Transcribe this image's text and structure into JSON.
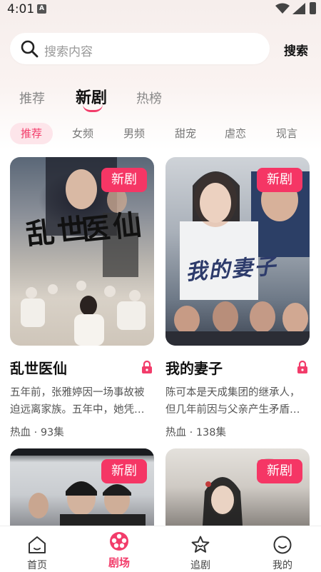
{
  "status_bar": {
    "time": "4:01",
    "notification_glyph": "A"
  },
  "search": {
    "placeholder": "搜索内容",
    "button_label": "搜索"
  },
  "top_tabs": [
    {
      "label": "推荐",
      "active": false
    },
    {
      "label": "新剧",
      "active": true
    },
    {
      "label": "热榜",
      "active": false
    }
  ],
  "categories": [
    {
      "label": "推荐",
      "active": true
    },
    {
      "label": "女频",
      "active": false
    },
    {
      "label": "男频",
      "active": false
    },
    {
      "label": "甜宠",
      "active": false
    },
    {
      "label": "虐恋",
      "active": false
    },
    {
      "label": "现言",
      "active": false
    }
  ],
  "cards": [
    {
      "badge": "新剧",
      "title": "乱世医仙",
      "desc_line1": "五年前，张雅婷因一场事故被",
      "desc_line2": "迫远离家族。五年中，她凭…",
      "meta": "热血 · 93集",
      "poster_text_1": "乱世",
      "poster_text_2": "医仙",
      "locked": true
    },
    {
      "badge": "新剧",
      "title": "我的妻子",
      "desc_line1": "陈可本是天成集团的继承人，",
      "desc_line2": "但几年前因与父亲产生矛盾…",
      "meta": "热血 · 138集",
      "poster_text": "我的妻子",
      "locked": true
    },
    {
      "badge": "新剧"
    },
    {
      "badge": "新剧"
    }
  ],
  "bottom_nav": [
    {
      "label": "首页",
      "icon": "home-icon",
      "active": false
    },
    {
      "label": "剧场",
      "icon": "film-reel-icon",
      "active": true
    },
    {
      "label": "追剧",
      "icon": "star-icon",
      "active": false
    },
    {
      "label": "我的",
      "icon": "smiley-icon",
      "active": false
    }
  ],
  "colors": {
    "accent": "#f23c6a",
    "badge": "#f53665",
    "chip_bg": "#fde5ea"
  }
}
